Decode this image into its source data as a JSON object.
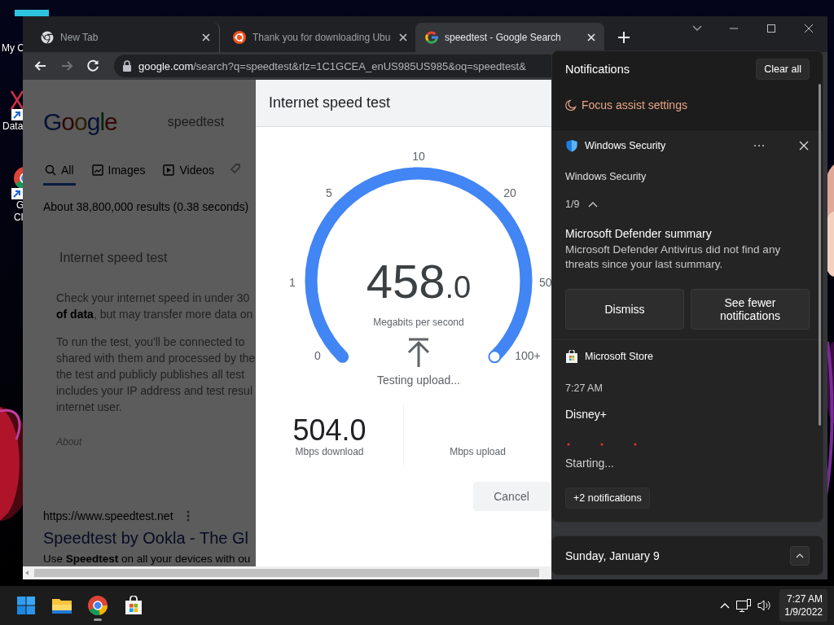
{
  "desktop_icons": [
    {
      "kind": "tile",
      "shortcut": false,
      "lines": [
        "My C"
      ]
    },
    {
      "kind": "cross",
      "shortcut": true,
      "lines": [
        "Data"
      ]
    },
    {
      "kind": "wheel",
      "shortcut": true,
      "lines": [
        "G",
        "Cl"
      ]
    }
  ],
  "browser": {
    "tabs": [
      {
        "kind": "chrome",
        "title": "New Tab",
        "selected": false
      },
      {
        "kind": "ubuntu",
        "title": "Thank you for downloading Ubu",
        "selected": false
      },
      {
        "kind": "google",
        "title": "speedtest - Google Search",
        "selected": true
      }
    ],
    "navigation": [
      {
        "kind": "back",
        "disabled": false
      },
      {
        "kind": "forward",
        "disabled": true
      },
      {
        "kind": "reload",
        "disabled": false
      }
    ],
    "address": {
      "host": "google.com",
      "path": "/search?q=speedtest&rlz=1C1GCEA_enUS985US985&oq=speedtest&"
    },
    "page": {
      "logo": "Google",
      "query": "speedtest",
      "tabs": [
        {
          "kind": "search",
          "label": "All",
          "selected": true
        },
        {
          "kind": "image",
          "label": "Images",
          "selected": false
        },
        {
          "kind": "video",
          "label": "Videos",
          "selected": false
        }
      ],
      "stats": "About 38,800,000 results (0.38 seconds)",
      "card_title": "Internet speed test",
      "paragraphs": [
        [
          "Check your internet speed in under 30",
          "**of data**, but may transfer more data on"
        ],
        [
          "To run the test, you'll be connected to",
          "shared with them and processed by the",
          "the test and publicly publishes all test",
          "includes your IP address and test resul",
          "internet user."
        ]
      ],
      "about": "About",
      "result": {
        "url": "https://www.speedtest.net",
        "title": "Speedtest by Ookla - The Gl",
        "snippet": "Use **Speedtest** on all your devices with ou"
      }
    },
    "speed_test": {
      "title": "Internet speed test",
      "scale": [
        "0",
        "1",
        "5",
        "10",
        "20",
        "50",
        "100+"
      ],
      "level": 1,
      "reading": "458",
      "reading_fraction": ".0",
      "unit": "Megabits per second",
      "status": "Testing upload...",
      "results": [
        {
          "value": "504.0",
          "label": "Mbps download"
        },
        {
          "label": "Mbps upload"
        }
      ],
      "cancel": "Cancel"
    }
  },
  "notifications": {
    "title": "Notifications",
    "clear": "Clear all",
    "focus": "Focus assist settings",
    "groups": [
      {
        "kind": "shield",
        "app": "Windows Security",
        "sender": "Windows Security",
        "counter": "1/9",
        "expanded": true,
        "heading": "Microsoft Defender summary",
        "body": "Microsoft Defender Antivirus did not find any threats since your last summary.",
        "actions": [
          "Dismiss",
          "See fewer notifications"
        ]
      },
      {
        "kind": "store",
        "app": "Microsoft Store",
        "time": "7:27 AM",
        "heading": "Disney+",
        "status": "Starting...",
        "more": "+2 notifications"
      }
    ]
  },
  "date_panel": {
    "date": "Sunday, January 9"
  },
  "taskbar": {
    "apps": [
      {
        "kind": "start",
        "running": false
      },
      {
        "kind": "files",
        "running": false
      },
      {
        "kind": "chrome",
        "running": true
      },
      {
        "kind": "store",
        "running": false
      }
    ],
    "time": "7:27 AM",
    "date": "1/9/2022"
  }
}
